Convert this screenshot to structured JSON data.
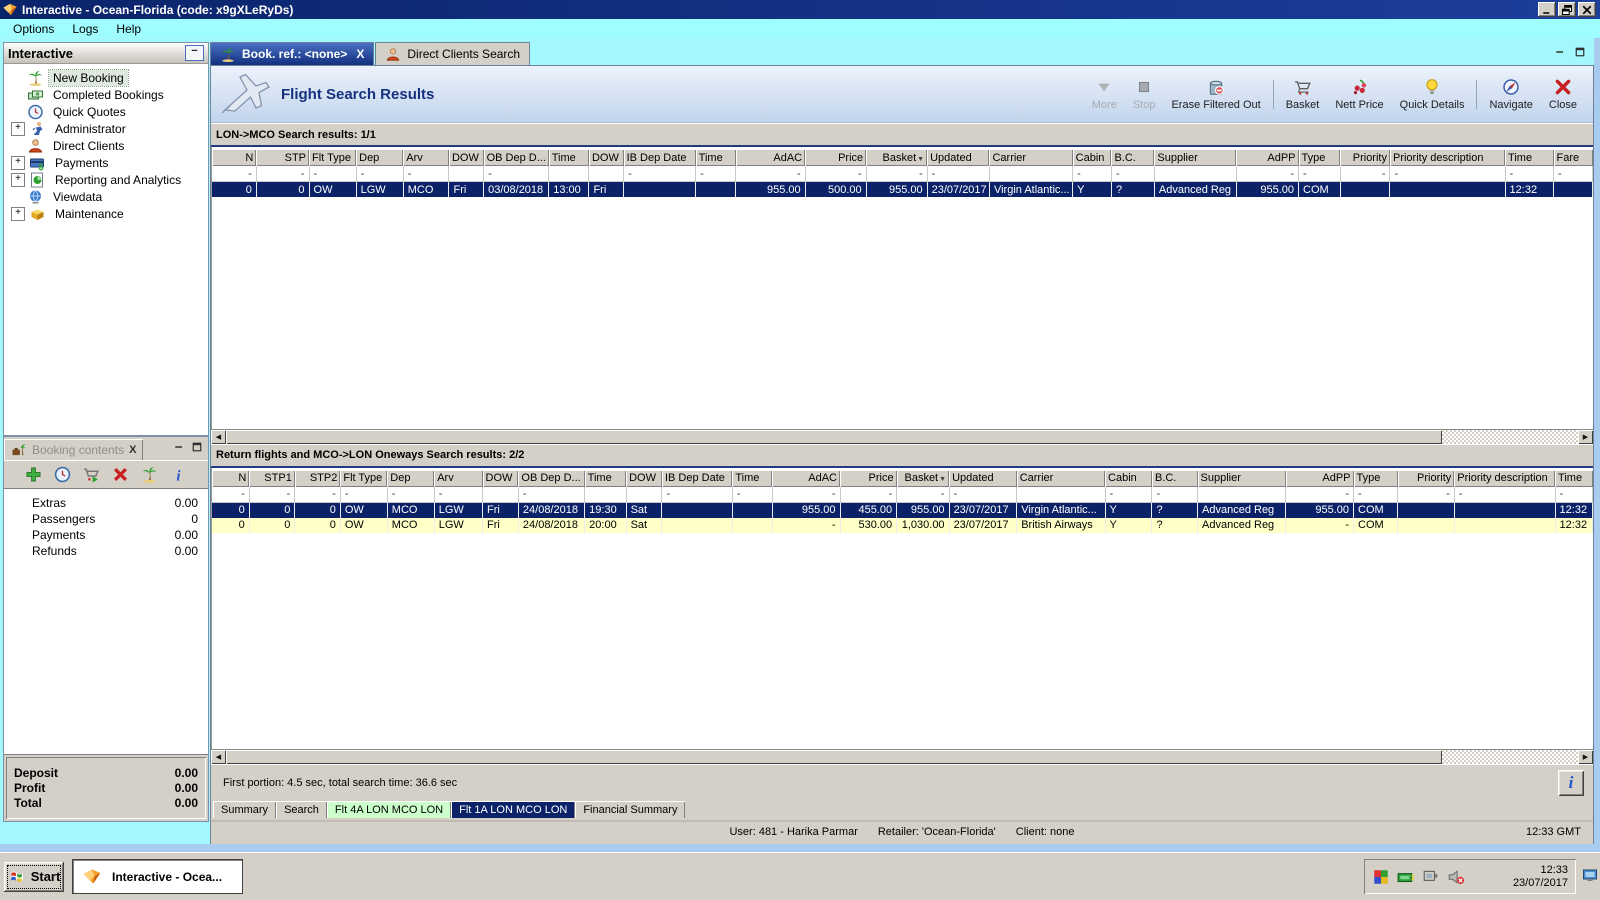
{
  "ui": {
    "close_glyph": "X",
    "collapse_glyph": "−",
    "expander_glyph": "+",
    "sort_desc_glyph": "▼",
    "scroll_left_glyph": "◀",
    "scroll_right_glyph": "▶",
    "info_glyph": "i"
  },
  "colors": {
    "titlebar": "#0a246a",
    "menubar": "#9ffcff",
    "selected_row": "#0b2268",
    "alt_row": "#ffffc8",
    "tab_active": "#12307e",
    "tab_active_light": "#4a70c2",
    "green_tab": "#ccffcc"
  },
  "titlebar": {
    "title": "Interactive - Ocean-Florida (code: x9gXLeRyDs)"
  },
  "menubar": {
    "items": [
      "Options",
      "Logs",
      "Help"
    ]
  },
  "sidebar": {
    "title": "Interactive",
    "items": [
      {
        "label": "New Booking",
        "icon": "palm-tree-icon",
        "expander": false,
        "selected": true
      },
      {
        "label": "Completed Bookings",
        "icon": "money-icon",
        "expander": false
      },
      {
        "label": "Quick Quotes",
        "icon": "clock-icon",
        "expander": false
      },
      {
        "label": "Administrator",
        "icon": "administrator-icon",
        "expander": true
      },
      {
        "label": "Direct Clients",
        "icon": "client-icon",
        "expander": false
      },
      {
        "label": "Payments",
        "icon": "payments-icon",
        "expander": true
      },
      {
        "label": "Reporting and Analytics",
        "icon": "report-icon",
        "expander": true
      },
      {
        "label": "Viewdata",
        "icon": "globe-icon",
        "expander": false
      },
      {
        "label": "Maintenance",
        "icon": "toolbox-icon",
        "expander": true
      }
    ]
  },
  "booking_contents": {
    "tab_label": "Booking contents",
    "toolbar_icons": [
      "add-icon",
      "clock-icon",
      "basket-add-icon",
      "delete-icon",
      "palm-tree-icon",
      "info-icon"
    ],
    "items": [
      {
        "label": "Extras",
        "value": "0.00"
      },
      {
        "label": "Passengers",
        "value": "0"
      },
      {
        "label": "Payments",
        "value": "0.00"
      },
      {
        "label": "Refunds",
        "value": "0.00"
      }
    ],
    "summary": [
      {
        "label": "Deposit",
        "value": "0.00"
      },
      {
        "label": "Profit",
        "value": "0.00"
      },
      {
        "label": "Total",
        "value": "0.00"
      }
    ]
  },
  "main_tabs": [
    {
      "label": "Book. ref.: <none>",
      "icon": "palm-tree-icon",
      "closable": true,
      "active": true
    },
    {
      "label": "Direct Clients Search",
      "icon": "client-icon",
      "closable": false,
      "active": false
    }
  ],
  "flight_header": {
    "title": "Flight Search Results",
    "buttons": [
      {
        "label": "More",
        "icon": "more-icon",
        "disabled": true
      },
      {
        "label": "Stop",
        "icon": "stop-icon",
        "disabled": true
      },
      {
        "label": "Erase Filtered Out",
        "icon": "erase-icon",
        "sep_after": true
      },
      {
        "label": "Basket",
        "icon": "basket-icon"
      },
      {
        "label": "Nett Price",
        "icon": "nett-price-icon"
      },
      {
        "label": "Quick Details",
        "icon": "bulb-icon",
        "sep_after": true
      },
      {
        "label": "Navigate",
        "icon": "navigate-icon"
      },
      {
        "label": "Close",
        "icon": "close-red-icon"
      }
    ]
  },
  "outbound": {
    "section_title": "LON->MCO Search results: 1/1",
    "columns": [
      {
        "label": "N",
        "align": "right",
        "w": 3.2
      },
      {
        "label": "STP",
        "align": "right",
        "w": 3.8
      },
      {
        "label": "Flt Type",
        "align": "left",
        "w": 3.4
      },
      {
        "label": "Dep",
        "align": "left",
        "w": 3.4
      },
      {
        "label": "Arv",
        "align": "left",
        "w": 3.3
      },
      {
        "label": "DOW",
        "align": "left",
        "w": 2.5
      },
      {
        "label": "OB Dep D...",
        "align": "left",
        "w": 4.7
      },
      {
        "label": "Time",
        "align": "left",
        "w": 2.9
      },
      {
        "label": "DOW",
        "align": "left",
        "w": 2.5
      },
      {
        "label": "IB Dep Date",
        "align": "left",
        "w": 5.2
      },
      {
        "label": "Time",
        "align": "left",
        "w": 2.9
      },
      {
        "label": "AdAC",
        "align": "right",
        "w": 5.0
      },
      {
        "label": "Price",
        "align": "right",
        "w": 4.4
      },
      {
        "label": "Basket",
        "align": "right",
        "w": 4.4,
        "sort": "desc"
      },
      {
        "label": "Updated",
        "align": "left",
        "w": 4.5
      },
      {
        "label": "Carrier",
        "align": "left",
        "w": 6.0
      },
      {
        "label": "Cabin",
        "align": "left",
        "w": 2.8
      },
      {
        "label": "B.C.",
        "align": "left",
        "w": 3.1
      },
      {
        "label": "Supplier",
        "align": "left",
        "w": 5.9
      },
      {
        "label": "AdPP",
        "align": "right",
        "w": 4.5
      },
      {
        "label": "Type",
        "align": "left",
        "w": 3.0
      },
      {
        "label": "Priority",
        "align": "right",
        "w": 3.6
      },
      {
        "label": "Priority description",
        "align": "left",
        "w": 8.3
      },
      {
        "label": "Time",
        "align": "left",
        "w": 3.5
      },
      {
        "label": "Fare",
        "align": "left",
        "w": 2.8
      }
    ],
    "filter": [
      "-",
      "-",
      "-",
      "-",
      "-",
      "",
      "-",
      "",
      "",
      "-",
      "-",
      "-",
      "-",
      "-",
      "-",
      "",
      "-",
      "-",
      "",
      "-",
      "-",
      "-",
      "-",
      "-",
      "-"
    ],
    "rows": [
      {
        "style": "selected",
        "cells": [
          "0",
          "0",
          "OW",
          "LGW",
          "MCO",
          "Fri",
          "03/08/2018",
          "13:00",
          "Fri",
          "",
          "",
          "955.00",
          "500.00",
          "955.00",
          "23/07/2017",
          "Virgin Atlantic...",
          "Y",
          "?",
          "Advanced Reg",
          "955.00",
          "COM",
          "",
          "",
          "12:32",
          ""
        ]
      }
    ]
  },
  "return_flights": {
    "section_title": "Return flights and MCO->LON Oneways Search results: 2/2",
    "columns": [
      {
        "label": "N",
        "align": "right",
        "w": 2.7
      },
      {
        "label": "STP1",
        "align": "right",
        "w": 3.3
      },
      {
        "label": "STP2",
        "align": "right",
        "w": 3.3
      },
      {
        "label": "Flt Type",
        "align": "left",
        "w": 3.4
      },
      {
        "label": "Dep",
        "align": "left",
        "w": 3.4
      },
      {
        "label": "Arv",
        "align": "left",
        "w": 3.5
      },
      {
        "label": "DOW",
        "align": "left",
        "w": 2.6
      },
      {
        "label": "OB Dep D...",
        "align": "left",
        "w": 4.8
      },
      {
        "label": "Time",
        "align": "left",
        "w": 3.0
      },
      {
        "label": "DOW",
        "align": "left",
        "w": 2.6
      },
      {
        "label": "IB Dep Date",
        "align": "left",
        "w": 5.1
      },
      {
        "label": "Time",
        "align": "left",
        "w": 2.9
      },
      {
        "label": "AdAC",
        "align": "right",
        "w": 4.9
      },
      {
        "label": "Price",
        "align": "right",
        "w": 4.1
      },
      {
        "label": "Basket",
        "align": "right",
        "w": 3.8,
        "sort": "desc"
      },
      {
        "label": "Updated",
        "align": "left",
        "w": 4.9
      },
      {
        "label": "Carrier",
        "align": "left",
        "w": 6.4
      },
      {
        "label": "Cabin",
        "align": "left",
        "w": 3.4
      },
      {
        "label": "B.C.",
        "align": "left",
        "w": 3.3
      },
      {
        "label": "Supplier",
        "align": "left",
        "w": 6.4
      },
      {
        "label": "AdPP",
        "align": "right",
        "w": 4.9
      },
      {
        "label": "Type",
        "align": "left",
        "w": 3.2
      },
      {
        "label": "Priority",
        "align": "right",
        "w": 4.1
      },
      {
        "label": "Priority description",
        "align": "left",
        "w": 7.3
      },
      {
        "label": "Time",
        "align": "left",
        "w": 2.7
      }
    ],
    "filter": [
      "-",
      "-",
      "-",
      "-",
      "-",
      "-",
      "",
      "-",
      "",
      "",
      "-",
      "-",
      "-",
      "-",
      "-",
      "-",
      "",
      "-",
      "-",
      "",
      "-",
      "-",
      "-",
      "-",
      "-"
    ],
    "rows": [
      {
        "style": "selected",
        "cells": [
          "0",
          "0",
          "0",
          "OW",
          "MCO",
          "LGW",
          "Fri",
          "24/08/2018",
          "19:30",
          "Sat",
          "",
          "",
          "955.00",
          "455.00",
          "955.00",
          "23/07/2017",
          "Virgin Atlantic...",
          "Y",
          "?",
          "Advanced Reg",
          "955.00",
          "COM",
          "",
          "",
          "12:32"
        ]
      },
      {
        "style": "yellow",
        "cells": [
          "0",
          "0",
          "0",
          "OW",
          "MCO",
          "LGW",
          "Fri",
          "24/08/2018",
          "20:00",
          "Sat",
          "",
          "",
          "-",
          "530.00",
          "1,030.00",
          "23/07/2017",
          "British Airways",
          "Y",
          "?",
          "Advanced Reg",
          "-",
          "COM",
          "",
          "",
          "12:32"
        ]
      }
    ]
  },
  "search_status": {
    "text": "First portion: 4.5 sec, total search time: 36.6 sec"
  },
  "bottom_tabs": [
    {
      "label": "Summary"
    },
    {
      "label": "Search"
    },
    {
      "label": "Flt 4A LON MCO LON",
      "highlight": "green"
    },
    {
      "label": "Flt 1A LON MCO LON",
      "highlight": "navy",
      "active": true
    },
    {
      "label": "Financial Summary"
    }
  ],
  "status_bar": {
    "user": "User: 481 - Harika Parmar",
    "retailer": "Retailer: 'Ocean-Florida'",
    "client": "Client: none",
    "time": "12:33 GMT"
  },
  "taskbar": {
    "start_label": "Start",
    "task_label": "Interactive - Ocea...",
    "tray_icons": [
      "antivirus-icon",
      "network-icon",
      "usb-icon",
      "volume-muted-icon"
    ],
    "clock": {
      "time": "12:33",
      "date": "23/07/2017"
    }
  }
}
